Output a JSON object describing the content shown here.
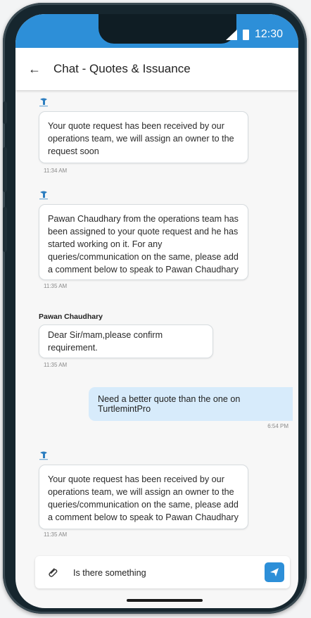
{
  "status_bar": {
    "time": "12:30"
  },
  "header": {
    "title": "Chat - Quotes & Issuance"
  },
  "messages": [
    {
      "text": "Your quote request has been received by our operations team, we will assign an owner to the request soon",
      "time": "11:34 AM"
    },
    {
      "text": "Pawan Chaudhary from the operations team has been assigned to your quote request and he has started working on it. For any queries/communication on the same, please add a comment below to speak to Pawan Chaudhary",
      "time": "11:35 AM"
    },
    {
      "sender": "Pawan Chaudhary",
      "text": "Dear Sir/mam,please confirm requirement.",
      "time": "11:35 AM"
    },
    {
      "text": "Need a better quote than the one on TurtlemintPro",
      "time": "6:54 PM"
    },
    {
      "text": "Your quote request has been received by our operations team, we will assign an owner to the queries/communication on the same, please add a comment below to speak to Pawan Chaudhary",
      "time": "11:35 AM"
    }
  ],
  "composer": {
    "value": "Is there something"
  },
  "colors": {
    "accent": "#2d8fd8",
    "outgoing_bubble": "#d7ebfb"
  },
  "icons": {
    "back": "back-arrow-icon",
    "attach": "paperclip-icon",
    "send": "send-icon",
    "bot": "turtlemint-logo-icon"
  }
}
